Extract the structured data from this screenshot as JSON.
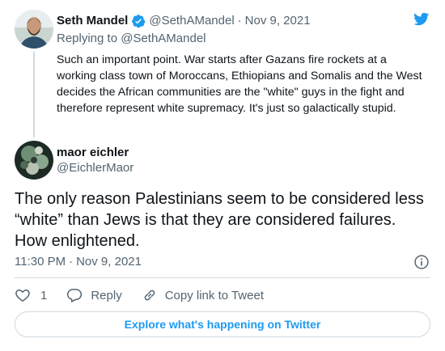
{
  "colors": {
    "brand": "#1d9bf0",
    "text": "#0f1419",
    "secondary": "#536471",
    "border": "#cfd9de"
  },
  "parent_tweet": {
    "author_name": "Seth Mandel",
    "verified": true,
    "handle": "@SethAMandel",
    "separator": "·",
    "date": "Nov 9, 2021",
    "replying_prefix": "Replying to",
    "replying_handle": "@SethAMandel",
    "text": "Such an important point. War starts after Gazans fire rockets at a working class town of Moroccans, Ethiopians and Somalis and the West decides the African communities are the \"white\" guys in the fight and therefore represent white supremacy. It's just so galactically stupid."
  },
  "main_tweet": {
    "author_name": "maor eichler",
    "handle": "@EichlerMaor",
    "text": "The only reason Palestinians seem to be considered less “white” than Jews is that they are considered failures. How enlightened.",
    "time": "11:30 PM",
    "separator": "·",
    "date": "Nov 9, 2021"
  },
  "actions": {
    "like_count": "1",
    "reply_label": "Reply",
    "copy_label": "Copy link to Tweet"
  },
  "explore_label": "Explore what's happening on Twitter",
  "icons": {
    "logo": "twitter-bird-icon",
    "verified": "verified-badge-icon",
    "info": "info-icon",
    "like": "heart-icon",
    "reply": "speech-bubble-icon",
    "copy": "link-icon"
  }
}
